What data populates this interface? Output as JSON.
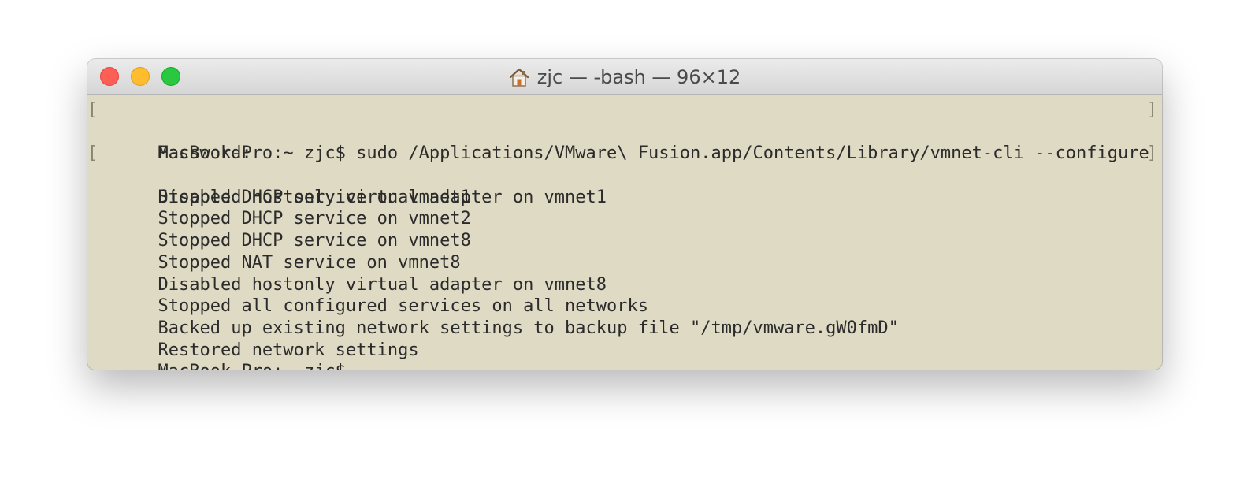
{
  "window": {
    "title": "zjc — -bash — 96×12",
    "title_icon": "home-icon",
    "colors": {
      "terminal_background": "#dfdac3",
      "text": "#2b2b2b",
      "close": "#fd5f57",
      "minimize": "#febc2e",
      "zoom": "#29c840"
    }
  },
  "terminal": {
    "lines": [
      "MacBook-Pro:~ zjc$ sudo /Applications/VMware\\ Fusion.app/Contents/Library/vmnet-cli --configure",
      "Password:",
      "Stopped DHCP service on vmnet1",
      "Disabled hostonly virtual adapter on vmnet1",
      "Stopped DHCP service on vmnet2",
      "Stopped DHCP service on vmnet8",
      "Stopped NAT service on vmnet8",
      "Disabled hostonly virtual adapter on vmnet8",
      "Stopped all configured services on all networks",
      "Backed up existing network settings to backup file \"/tmp/vmware.gW0fmD\"",
      "Restored network settings",
      "MacBook-Pro:~ zjc$"
    ],
    "bracket_open": "[",
    "bracket_close": "]"
  }
}
